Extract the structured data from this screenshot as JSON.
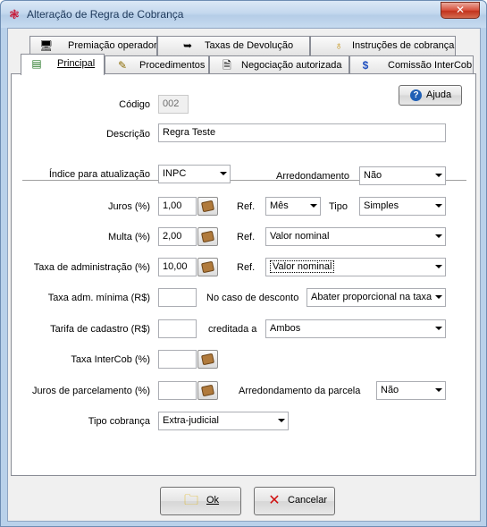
{
  "window": {
    "title": "Alteração de Regra de Cobrança",
    "close_label": "✕"
  },
  "tabs_row1": [
    {
      "label": "Premiação operador",
      "icon": "computer-icon"
    },
    {
      "label": "Taxas de Devolução",
      "icon": "return-arrow-icon"
    },
    {
      "label": "Instruções de cobrança",
      "icon": "bulb-icon"
    }
  ],
  "tabs_row2": [
    {
      "label": "Principal",
      "icon": "form-icon",
      "active": true
    },
    {
      "label": "Procedimentos",
      "icon": "pencil-icon"
    },
    {
      "label": "Negociação autorizada",
      "icon": "document-icon"
    },
    {
      "label": "Comissão InterCob",
      "icon": "dollar-icon"
    }
  ],
  "help_button": "Ajuda",
  "form": {
    "codigo_label": "Código",
    "codigo_value": "002",
    "descricao_label": "Descrição",
    "descricao_value": "Regra Teste",
    "indice_label": "Índice para atualização",
    "indice_value": "INPC",
    "arredondamento_label": "Arredondamento",
    "arredondamento_value": "Não",
    "juros_label": "Juros (%)",
    "juros_value": "1,00",
    "ref_label": "Ref.",
    "juros_ref_value": "Mês",
    "tipo_label": "Tipo",
    "tipo_value": "Simples",
    "multa_label": "Multa (%)",
    "multa_value": "2,00",
    "multa_ref_value": "Valor nominal",
    "taxa_adm_label": "Taxa de administração (%)",
    "taxa_adm_value": "10,00",
    "taxa_adm_ref_value": "Valor nominal",
    "taxa_adm_min_label": "Taxa adm. mínima  (R$)",
    "taxa_adm_min_value": "",
    "desconto_label": "No caso de desconto",
    "desconto_value": "Abater proporcional na taxa",
    "tarifa_label": "Tarifa de cadastro (R$)",
    "tarifa_value": "",
    "creditada_label": "creditada a",
    "creditada_value": "Ambos",
    "intercob_label": "Taxa InterCob (%)",
    "intercob_value": "",
    "parcelamento_label": "Juros de parcelamento (%)",
    "parcelamento_value": "",
    "arred_parcela_label": "Arredondamento da parcela",
    "arred_parcela_value": "Não",
    "tipo_cobranca_label": "Tipo cobrança",
    "tipo_cobranca_value": "Extra-judicial"
  },
  "buttons": {
    "ok": "Ok",
    "cancel": "Cancelar"
  }
}
